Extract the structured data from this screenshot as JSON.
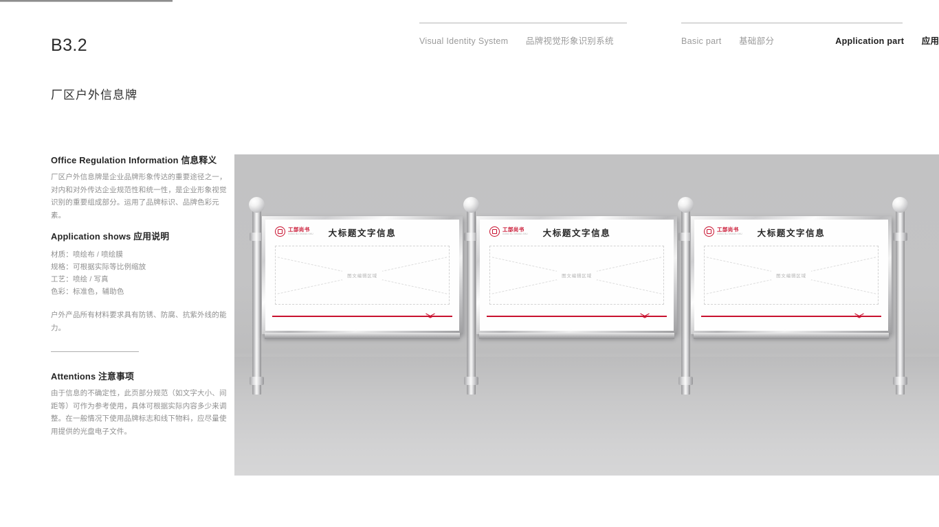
{
  "header": {
    "code": "B3.2",
    "section_title": "厂区户外信息牌",
    "nav_left": {
      "en": "Visual Identity System",
      "cn": "品牌视觉形象识别系统"
    },
    "nav_right": {
      "basic_en": "Basic part",
      "basic_cn": "基础部分",
      "app_en": "Application part",
      "app_cn": "应用部分"
    }
  },
  "info": {
    "heading_en": "Office Regulation Information",
    "heading_cn": "信息释义",
    "body": "厂区户外信息牌是企业品牌形象传达的重要途径之一，对内和对外传达企业规范性和统一性，是企业形象视觉识别的重要组成部分。运用了品牌标识、品牌色彩元素。"
  },
  "application": {
    "heading_en": "Application shows",
    "heading_cn": "应用说明",
    "specs": [
      "材质：喷绘布 / 喷绘膜",
      "规格：可根据实际等比例缩放",
      "工艺：喷绘 / 写真",
      "色彩：标准色，辅助色"
    ],
    "note": "户外产品所有材料要求具有防锈、防腐、抗紫外线的能力。"
  },
  "attentions": {
    "heading_en": "Attentions",
    "heading_cn": "注意事项",
    "body": "由于信息的不确定性，此页部分规范（如文字大小、间距等）可作为参考使用，具体可根据实际内容多少来调整。在一般情况下使用品牌标志和线下物料，应尽量使用提供的光盘电子文件。"
  },
  "mockup": {
    "boards": [
      {
        "title": "大标题文字信息",
        "placeholder": "图文编辑区域",
        "logo_cn": "工部尚书",
        "logo_en": "GONG BU SHANG SHU"
      },
      {
        "title": "大标题文字信息",
        "placeholder": "图文编辑区域",
        "logo_cn": "工部尚书",
        "logo_en": "GONG BU SHANG SHU"
      },
      {
        "title": "大标题文字信息",
        "placeholder": "图文编辑区域",
        "logo_cn": "工部尚书",
        "logo_en": "GONG BU SHANG SHU"
      }
    ],
    "colors": {
      "brand_red": "#c8102e",
      "backdrop": "#c2c2c3",
      "metal": "#d9d9db"
    }
  }
}
